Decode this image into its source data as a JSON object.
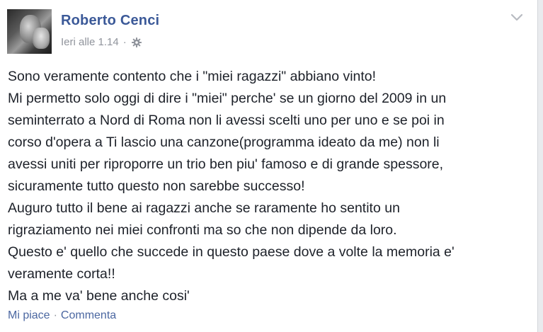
{
  "post": {
    "author": "Roberto Cenci",
    "timestamp": "Ieri alle 1.14",
    "separator": "·",
    "privacy_icon": "gear-icon",
    "menu_icon": "chevron-down-icon",
    "body_lines": [
      "Sono veramente contento che i \"miei ragazzi\" abbiano vinto!",
      "Mi permetto solo oggi di dire i \"miei\" perche' se un giorno del 2009 in un",
      "seminterrato a Nord di Roma non li avessi scelti uno per uno e se poi in",
      "corso d'opera a Ti lascio una canzone(programma ideato da me) non li",
      "avessi uniti per riproporre un trio ben piu' famoso e di grande spessore,",
      "sicuramente tutto questo non sarebbe successo!",
      "Auguro tutto il bene ai ragazzi anche se raramente ho sentito un",
      "rigraziamento nei miei confronti ma so che non dipende da loro.",
      "Questo e' quello che succede in questo paese dove a volte la memoria e'",
      "veramente corta!!",
      "Ma a me va' bene anche cosi'"
    ]
  },
  "actions": {
    "like_label": "Mi piace",
    "separator": "·",
    "comment_label": "Commenta"
  },
  "colors": {
    "author": "#3b5998",
    "meta": "#90949c",
    "text": "#1d2129",
    "link": "#4b67a1"
  }
}
